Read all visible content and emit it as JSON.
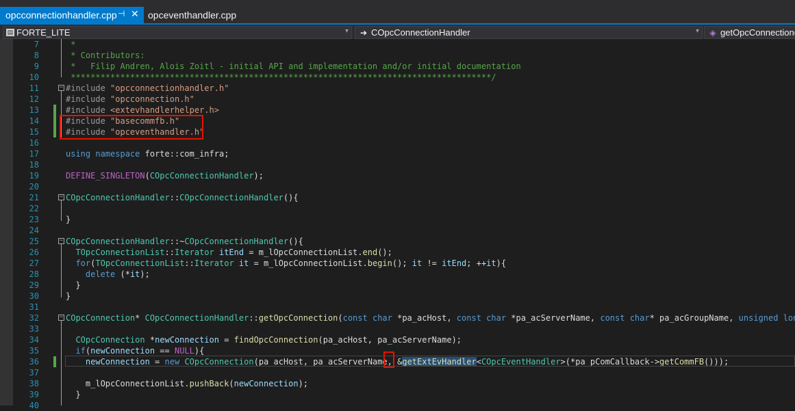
{
  "tabs": [
    {
      "label": "opcconnectionhandler.cpp",
      "active": true,
      "pin_glyph": "⊣",
      "close_glyph": "✕"
    },
    {
      "label": "opceventhandler.cpp",
      "active": false
    }
  ],
  "navbar": {
    "project": "FORTE_LITE",
    "scope": "COpcConnectionHandler",
    "member": "getOpcConnection("
  },
  "editor": {
    "lines": [
      {
        "n": "7",
        "text": " *"
      },
      {
        "n": "8",
        "text": " * Contributors:"
      },
      {
        "n": "9",
        "text": " *   Filip Andren, Alois Zoitl - initial API and implementation and/or initial documentation"
      },
      {
        "n": "10",
        "text": " *************************************************************************************/"
      },
      {
        "n": "11",
        "text": "#include \"opcconnectionhandler.h\""
      },
      {
        "n": "12",
        "text": "#include \"opcconnection.h\""
      },
      {
        "n": "13",
        "text": "#include <extevhandlerhelper.h>"
      },
      {
        "n": "14",
        "text": "#include \"basecommfb.h\""
      },
      {
        "n": "15",
        "text": "#include \"opceventhandler.h\""
      },
      {
        "n": "16",
        "text": ""
      },
      {
        "n": "17",
        "text": "using namespace forte::com_infra;"
      },
      {
        "n": "18",
        "text": ""
      },
      {
        "n": "19",
        "text": "DEFINE_SINGLETON(COpcConnectionHandler);"
      },
      {
        "n": "20",
        "text": ""
      },
      {
        "n": "21",
        "text": "COpcConnectionHandler::COpcConnectionHandler(){"
      },
      {
        "n": "22",
        "text": ""
      },
      {
        "n": "23",
        "text": "}"
      },
      {
        "n": "24",
        "text": ""
      },
      {
        "n": "25",
        "text": "COpcConnectionHandler::~COpcConnectionHandler(){"
      },
      {
        "n": "26",
        "text": "  TOpcConnectionList::Iterator itEnd = m_lOpcConnectionList.end();"
      },
      {
        "n": "27",
        "text": "  for(TOpcConnectionList::Iterator it = m_lOpcConnectionList.begin(); it != itEnd; ++it){"
      },
      {
        "n": "28",
        "text": "    delete (*it);"
      },
      {
        "n": "29",
        "text": "  }"
      },
      {
        "n": "30",
        "text": "}"
      },
      {
        "n": "31",
        "text": ""
      },
      {
        "n": "32",
        "text": "COpcConnection* COpcConnectionHandler::getOpcConnection(const char *pa_acHost, const char *pa_acServerName, const char* pa_acGroupName, unsigned long pa_"
      },
      {
        "n": "33",
        "text": ""
      },
      {
        "n": "34",
        "text": "  COpcConnection *newConnection = findOpcConnection(pa_acHost, pa_acServerName);"
      },
      {
        "n": "35",
        "text": "  if(newConnection == NULL){"
      },
      {
        "n": "36",
        "text": "    newConnection = new COpcConnection(pa_acHost, pa_acServerName, &getExtEvHandler<COpcEventHandler>(*pa_pComCallback->getCommFB()));"
      },
      {
        "n": "37",
        "text": ""
      },
      {
        "n": "38",
        "text": "    m_lOpcConnectionList.pushBack(newConnection);"
      },
      {
        "n": "39",
        "text": "  }"
      },
      {
        "n": "40",
        "text": ""
      }
    ]
  },
  "colors": {
    "accent": "#007acc",
    "background": "#1e1e1e",
    "highlight_box": "#e51400",
    "change_marker": "#57a64a"
  }
}
